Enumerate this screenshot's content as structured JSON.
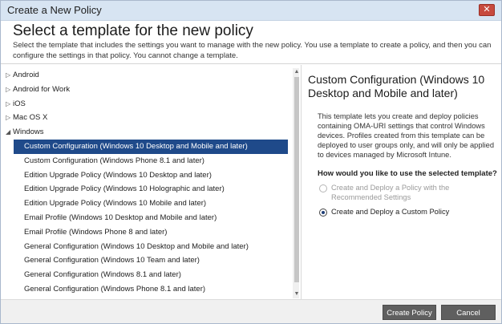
{
  "window": {
    "title": "Create a New Policy",
    "close_glyph": "✕"
  },
  "header": {
    "heading": "Select a template for the new policy",
    "description": "Select the template that includes the settings you want to manage with the new policy. You use a template to create a policy, and then you can configure the settings in that policy. You cannot change a template."
  },
  "tree": {
    "platforms": [
      {
        "label": "Android",
        "expanded": false
      },
      {
        "label": "Android for Work",
        "expanded": false
      },
      {
        "label": "iOS",
        "expanded": false
      },
      {
        "label": "Mac OS X",
        "expanded": false
      },
      {
        "label": "Windows",
        "expanded": true
      }
    ],
    "windows_templates": [
      {
        "label": "Custom Configuration (Windows 10 Desktop and Mobile and later)",
        "selected": true
      },
      {
        "label": "Custom Configuration (Windows Phone 8.1 and later)",
        "selected": false
      },
      {
        "label": "Edition Upgrade Policy (Windows 10 Desktop and later)",
        "selected": false
      },
      {
        "label": "Edition Upgrade Policy (Windows 10 Holographic and later)",
        "selected": false
      },
      {
        "label": "Edition Upgrade Policy (Windows 10 Mobile and later)",
        "selected": false
      },
      {
        "label": "Email Profile (Windows 10 Desktop and Mobile and later)",
        "selected": false
      },
      {
        "label": "Email Profile (Windows Phone 8 and later)",
        "selected": false
      },
      {
        "label": "General Configuration (Windows 10 Desktop and Mobile and later)",
        "selected": false
      },
      {
        "label": "General Configuration (Windows 10 Team and later)",
        "selected": false
      },
      {
        "label": "General Configuration (Windows 8.1 and later)",
        "selected": false
      },
      {
        "label": "General Configuration (Windows Phone 8.1 and later)",
        "selected": false
      }
    ]
  },
  "details": {
    "title": "Custom Configuration (Windows 10 Desktop and Mobile and later)",
    "description": "This template lets you create and deploy policies containing OMA-URI settings that control Windows devices. Profiles created from this template can be deployed to user groups only, and will only be applied to devices managed by Microsoft Intune.",
    "question": "How would you like to use the selected template?",
    "options": [
      {
        "label": "Create and Deploy a Policy with the Recommended Settings",
        "checked": false,
        "disabled": true
      },
      {
        "label": "Create and Deploy a Custom Policy",
        "checked": true,
        "disabled": false
      }
    ]
  },
  "footer": {
    "create_label": "Create Policy",
    "cancel_label": "Cancel"
  },
  "colors": {
    "selection": "#1f4a8a",
    "button": "#5f5f5f",
    "titlebar": "#d7e4f2"
  }
}
